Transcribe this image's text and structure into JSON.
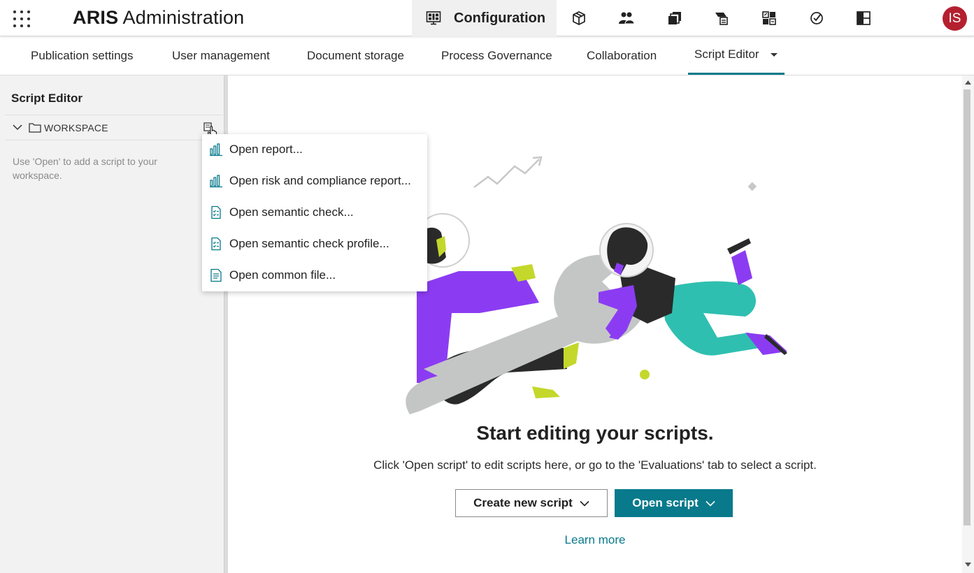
{
  "header": {
    "app_title_bold": "ARIS",
    "app_title_rest": "Administration",
    "config_label": "Configuration",
    "user_initials": "IS",
    "icons": [
      "grid-menu-icon",
      "configuration-icon",
      "package-icon",
      "users-icon",
      "documents-icon",
      "publish-icon",
      "dashboard-icon",
      "checklist-icon",
      "layout-icon"
    ],
    "avatar_color": "#b5202f"
  },
  "tabs": [
    {
      "label": "Publication settings"
    },
    {
      "label": "User management"
    },
    {
      "label": "Document storage"
    },
    {
      "label": "Process Governance"
    },
    {
      "label": "Collaboration"
    },
    {
      "label": "Script Editor",
      "active": true
    }
  ],
  "sidebar": {
    "title": "Script Editor",
    "workspace_label": "WORKSPACE",
    "hint": "Use 'Open' to add a script to your workspace."
  },
  "menu": {
    "items": [
      {
        "label": "Open report...",
        "icon": "bar-chart-icon"
      },
      {
        "label": "Open risk and compliance report...",
        "icon": "bar-chart-icon"
      },
      {
        "label": "Open semantic check...",
        "icon": "checklist-doc-icon"
      },
      {
        "label": "Open semantic check profile...",
        "icon": "checklist-doc-icon"
      },
      {
        "label": "Open common file...",
        "icon": "text-doc-icon"
      }
    ]
  },
  "main": {
    "headline": "Start editing your scripts.",
    "subline": "Click 'Open script' to edit scripts here, or go to the 'Evaluations' tab to select a script.",
    "create_button": "Create new script",
    "open_button": "Open script",
    "learn_more": "Learn more"
  },
  "colors": {
    "accent": "#087a8c",
    "purple": "#8b3cf2",
    "teal_figure": "#2fbfb0",
    "lime": "#c3d82a"
  }
}
